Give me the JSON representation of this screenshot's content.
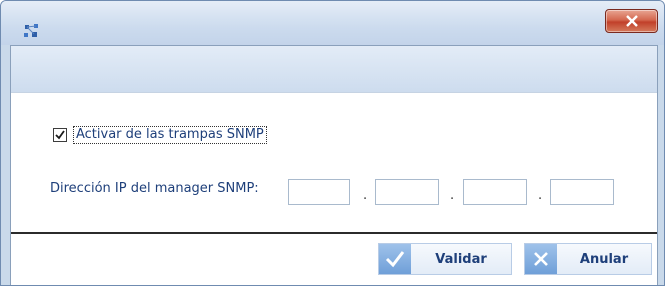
{
  "dialog": {
    "app_icon": "snmp-network-icon",
    "close_icon": "close-icon"
  },
  "form": {
    "trap_checkbox": {
      "label": "Activar de las trampas SNMP",
      "checked": true
    },
    "ip_label": "Dirección IP del manager SNMP:",
    "ip_octets": [
      "",
      "",
      "",
      ""
    ],
    "ip_separators": [
      ".",
      ".",
      "."
    ]
  },
  "footer": {
    "validate_label": "Validar",
    "validate_icon": "checkmark-icon",
    "cancel_label": "Anular",
    "cancel_icon": "x-icon"
  }
}
